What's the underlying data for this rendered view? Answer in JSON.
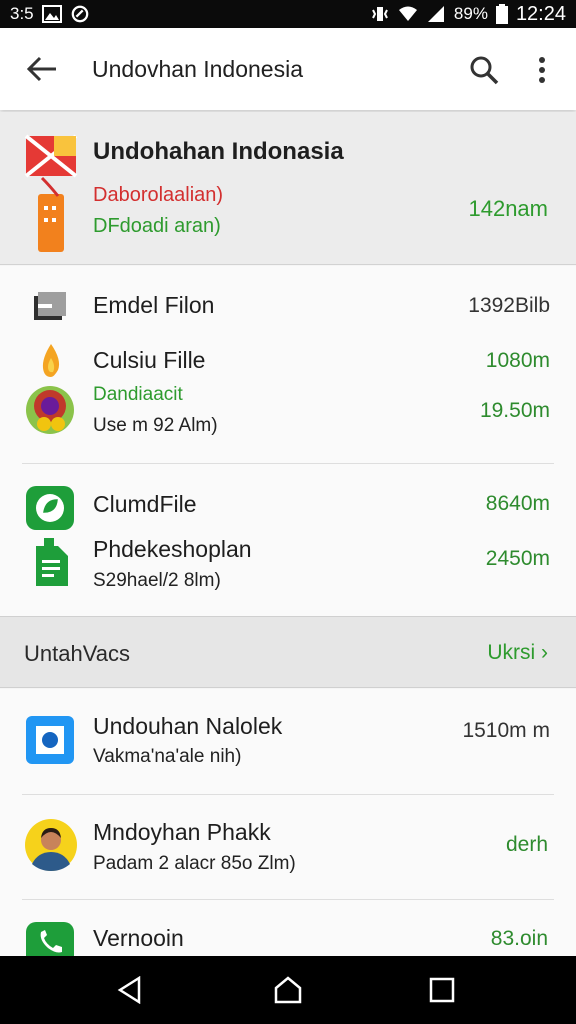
{
  "status_bar": {
    "left_text": "3:5",
    "battery": "89%",
    "time": "12:24"
  },
  "app_bar": {
    "title": "Undovhan Indonesia",
    "icons": [
      "back-arrow-icon",
      "search-icon",
      "more-vert-icon"
    ]
  },
  "featured": {
    "title": "Undohahan Indonasia",
    "sub1": "Daborolaalian)",
    "sub2": "DFdoadi aran)",
    "size": "142nam"
  },
  "group1": {
    "items": [
      {
        "name": "Emdel Filon",
        "size": "1392Bilb",
        "icon": "file-box-icon"
      },
      {
        "name": "Culsiu Fille",
        "size": "1080m",
        "icon": "flame-icon"
      },
      {
        "sub_green": "Dandiaacit",
        "size": "19.50m",
        "icon": "flower-icon"
      },
      {
        "sub": "Use m 92 Alm)"
      }
    ]
  },
  "group2": {
    "items": [
      {
        "name": "ClumdFile",
        "size": "8640m",
        "icon": "leaf-app-icon"
      },
      {
        "name": "Phdekeshoplan",
        "size": "2450m",
        "icon": "document-icon"
      },
      {
        "sub": "S29hael/2 8lm)"
      }
    ]
  },
  "section": {
    "title": "UntahVacs",
    "link": "Ukrsi",
    "link_icon": "chevron-right-icon"
  },
  "group3": {
    "items": [
      {
        "name": "Undouhan Nalolek",
        "sub": "Vakma'na'ale nih)",
        "size": "1510m m",
        "icon": "blue-square-app-icon"
      },
      {
        "name": "Mndoyhan Phakk",
        "sub": "Padam 2 alacr 85o Zlm)",
        "size": "derh",
        "icon": "avatar-icon"
      },
      {
        "name": "Vernooin",
        "size": "83.oin",
        "icon": "phone-app-icon"
      }
    ]
  },
  "nav_bar": {
    "icons": [
      "nav-back-icon",
      "nav-home-icon",
      "nav-recents-icon"
    ]
  },
  "colors": {
    "accent_green": "#2e9b2e",
    "accent_red": "#d32f2f",
    "status_bar": "#0b0b0b"
  }
}
